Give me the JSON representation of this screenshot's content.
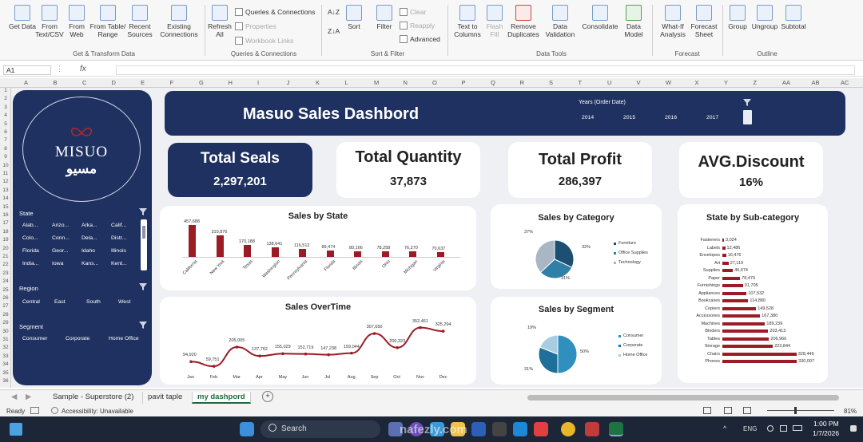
{
  "ribbon": {
    "get_data": "Get Data",
    "from_text": "From Text/CSV",
    "from_web": "From Web",
    "from_table": "From Table/ Range",
    "recent_sources": "Recent Sources",
    "existing_connections": "Existing Connections",
    "refresh_all": "Refresh All",
    "queries_connections": "Queries & Connections",
    "properties": "Properties",
    "workbook_links": "Workbook Links",
    "sort_az": "A↓Z",
    "sort_za": "Z↓A",
    "sort": "Sort",
    "filter": "Filter",
    "clear": "Clear",
    "reapply": "Reapply",
    "advanced": "Advanced",
    "text_to_columns": "Text to Columns",
    "flash_fill": "Flash Fill",
    "remove_duplicates": "Remove Duplicates",
    "data_validation": "Data Validation",
    "consolidate": "Consolidate",
    "data_model": "Data Model",
    "what_if": "What-If Analysis",
    "forecast_sheet": "Forecast Sheet",
    "group": "Group",
    "ungroup": "Ungroup",
    "subtotal": "Subtotal",
    "groups": [
      "Get & Transform Data",
      "Queries & Connections",
      "Sort & Filter",
      "Data Tools",
      "Forecast",
      "Outline"
    ]
  },
  "formula_bar": {
    "name_box": "A1",
    "fx": "fx",
    "dots": "⋮"
  },
  "columns": [
    "A",
    "B",
    "C",
    "D",
    "E",
    "F",
    "G",
    "H",
    "I",
    "J",
    "K",
    "L",
    "M",
    "N",
    "O",
    "P",
    "Q",
    "R",
    "S",
    "T",
    "U",
    "V",
    "W",
    "X",
    "Y",
    "Z",
    "AA",
    "AB",
    "AC"
  ],
  "rows": [
    "1",
    "2",
    "3",
    "4",
    "5",
    "6",
    "7",
    "8",
    "9",
    "10",
    "11",
    "12",
    "13",
    "14",
    "15",
    "16",
    "17",
    "18",
    "19",
    "20",
    "21",
    "22",
    "23",
    "24",
    "25",
    "26",
    "27",
    "28",
    "29",
    "30",
    "31",
    "32",
    "33",
    "34",
    "35",
    "36"
  ],
  "sidebar": {
    "logo_main": "MISUO",
    "logo_arabic": "مسيو",
    "state_title": "State",
    "states": [
      "Alab...",
      "Arizo...",
      "Arka...",
      "Calif...",
      "Colo...",
      "Conn...",
      "Dela...",
      "Distr...",
      "Florida",
      "Geor...",
      "Idaho",
      "Illinois",
      "India...",
      "Iowa",
      "Kans...",
      "Kent..."
    ],
    "region_title": "Region",
    "regions": [
      "Central",
      "East",
      "South",
      "West"
    ],
    "segment_title": "Segment",
    "segments": [
      "Consumer",
      "Corporate",
      "Home Office"
    ]
  },
  "header": {
    "title": "Masuo Sales Dashbord",
    "years_title": "Years (Order Date)",
    "years": [
      "2014",
      "2015",
      "2016",
      "2017"
    ]
  },
  "kpis": [
    {
      "label": "Total Seals",
      "value": "2,297,201"
    },
    {
      "label": "Total Quantity",
      "value": "37,873"
    },
    {
      "label": "Total Profit",
      "value": "286,397"
    },
    {
      "label": "AVG.Discount",
      "value": "16%"
    }
  ],
  "chart_data": [
    {
      "type": "bar",
      "title": "Sales by State",
      "categories": [
        "California",
        "New York",
        "Texas",
        "Washington",
        "Pennsylvania",
        "Florida",
        "Illinois",
        "Ohio",
        "Michigan",
        "Virginia"
      ],
      "values": [
        457688,
        310876,
        170188,
        138641,
        116512,
        89474,
        80166,
        78258,
        76270,
        70637
      ],
      "value_labels": [
        "457,688",
        "310,876",
        "170,188",
        "138,641",
        "116,512",
        "89,474",
        "80,166",
        "78,258",
        "76,270",
        "70,637"
      ]
    },
    {
      "type": "pie",
      "title": "Sales by Category",
      "legend": [
        "Furniture",
        "Office Supplies",
        "Technology"
      ],
      "values": [
        32,
        31,
        37
      ],
      "labels": [
        "32%",
        "31%",
        "37%"
      ],
      "colors": [
        "#1d4f73",
        "#2f7fa6",
        "#a9b7c4"
      ]
    },
    {
      "type": "bar",
      "title": "State by Sub-category",
      "categories": [
        "Fasteners",
        "Labels",
        "Envelopes",
        "Art",
        "Supplies",
        "Paper",
        "Furnishings",
        "Appliances",
        "Bookcases",
        "Copiers",
        "Accessories",
        "Machines",
        "Binders",
        "Tables",
        "Storage",
        "Chairs",
        "Phones"
      ],
      "values": [
        3024,
        12486,
        16476,
        27119,
        46674,
        78479,
        91705,
        107532,
        114880,
        149528,
        167380,
        189239,
        203413,
        206966,
        223844,
        328449,
        330007
      ],
      "value_labels": [
        "3,024",
        "12,486",
        "16,476",
        "27,119",
        "46,674",
        "78,479",
        "91,705",
        "107,532",
        "114,880",
        "149,528",
        "167,380",
        "189,239",
        "203,413",
        "206,966",
        "223,844",
        "328,449",
        "330,007"
      ]
    },
    {
      "type": "line",
      "title": "Sales OverTime",
      "categories": [
        "Jan",
        "Feb",
        "Mar",
        "Apr",
        "May",
        "Jun",
        "Jul",
        "Aug",
        "Sep",
        "Oct",
        "Nov",
        "Dec"
      ],
      "values": [
        94920,
        59751,
        205005,
        137762,
        155029,
        152719,
        147238,
        159044,
        307650,
        200323,
        352461,
        325294
      ],
      "value_labels": [
        "94,920",
        "59,751",
        "205,005",
        "137,762",
        "155,029",
        "152,719",
        "147,238",
        "159,044",
        "307,650",
        "200,323",
        "352,461",
        "325,294"
      ]
    },
    {
      "type": "pie",
      "title": "Sales by Segment",
      "legend": [
        "Consumer",
        "Corporate",
        "Home Office"
      ],
      "values": [
        50,
        31,
        19
      ],
      "labels": [
        "50%",
        "31%",
        "19%"
      ],
      "colors": [
        "#2f8fbf",
        "#1e6f9a",
        "#a9cde0"
      ]
    }
  ],
  "tabs": {
    "sheets": [
      "Sample - Superstore (2)",
      "pavit taple",
      "my dashpord"
    ],
    "add": "+"
  },
  "status": {
    "ready": "Ready",
    "accessibility": "Accessibility: Unavailable",
    "zoom": "81%"
  },
  "taskbar": {
    "search": "Search",
    "time": "1:00 PM",
    "date": "1/7/2026",
    "lang": "ENG",
    "watermark": "nafezly.com"
  }
}
